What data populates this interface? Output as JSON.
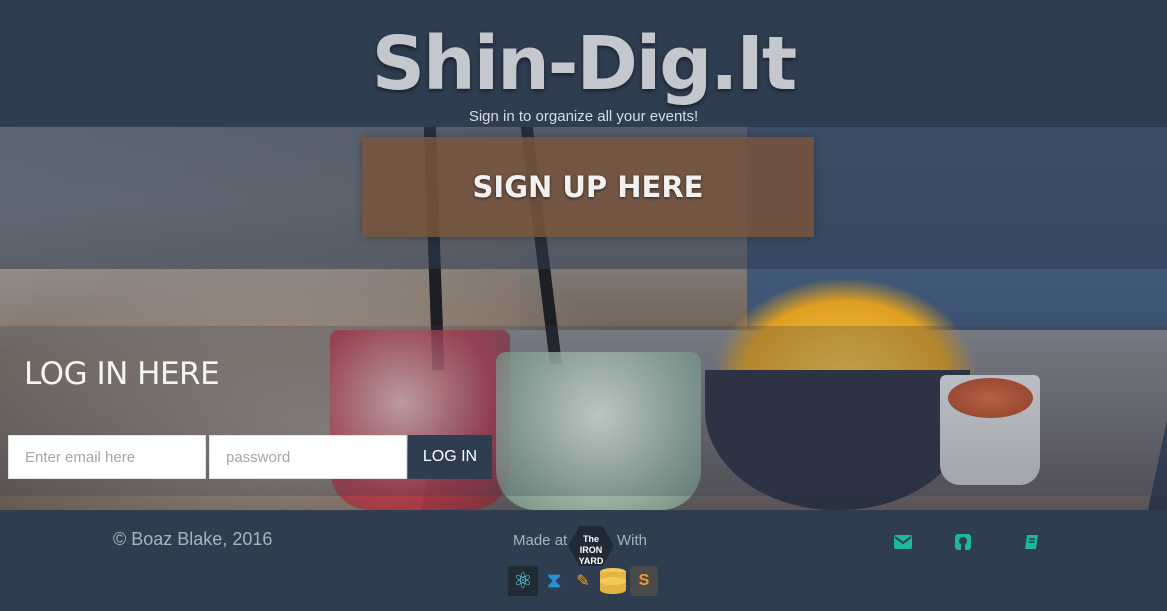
{
  "header": {
    "title": "Shin-Dig.It",
    "subtitle": "Sign in to organize all your events!"
  },
  "signup": {
    "label": "SIGN UP HERE"
  },
  "login": {
    "heading": "LOG IN HERE",
    "email_placeholder": "Enter email here",
    "password_placeholder": "password",
    "button_label": "LOG IN"
  },
  "footer": {
    "copyright": "© Boaz Blake, 2016",
    "made_at": "Made at",
    "with": "With",
    "iron_yard_logo": "The IRON YARD",
    "tech_icons": [
      "react-icon",
      "backbone-icon",
      "pen-icon",
      "database-icon",
      "sublime-text-icon"
    ],
    "social_icons": [
      "envelope-icon",
      "github-icon",
      "book-icon"
    ]
  },
  "colors": {
    "navy": "#2e3d50",
    "accent_teal": "#1fb6a0",
    "signup_brown": "#78553c"
  }
}
